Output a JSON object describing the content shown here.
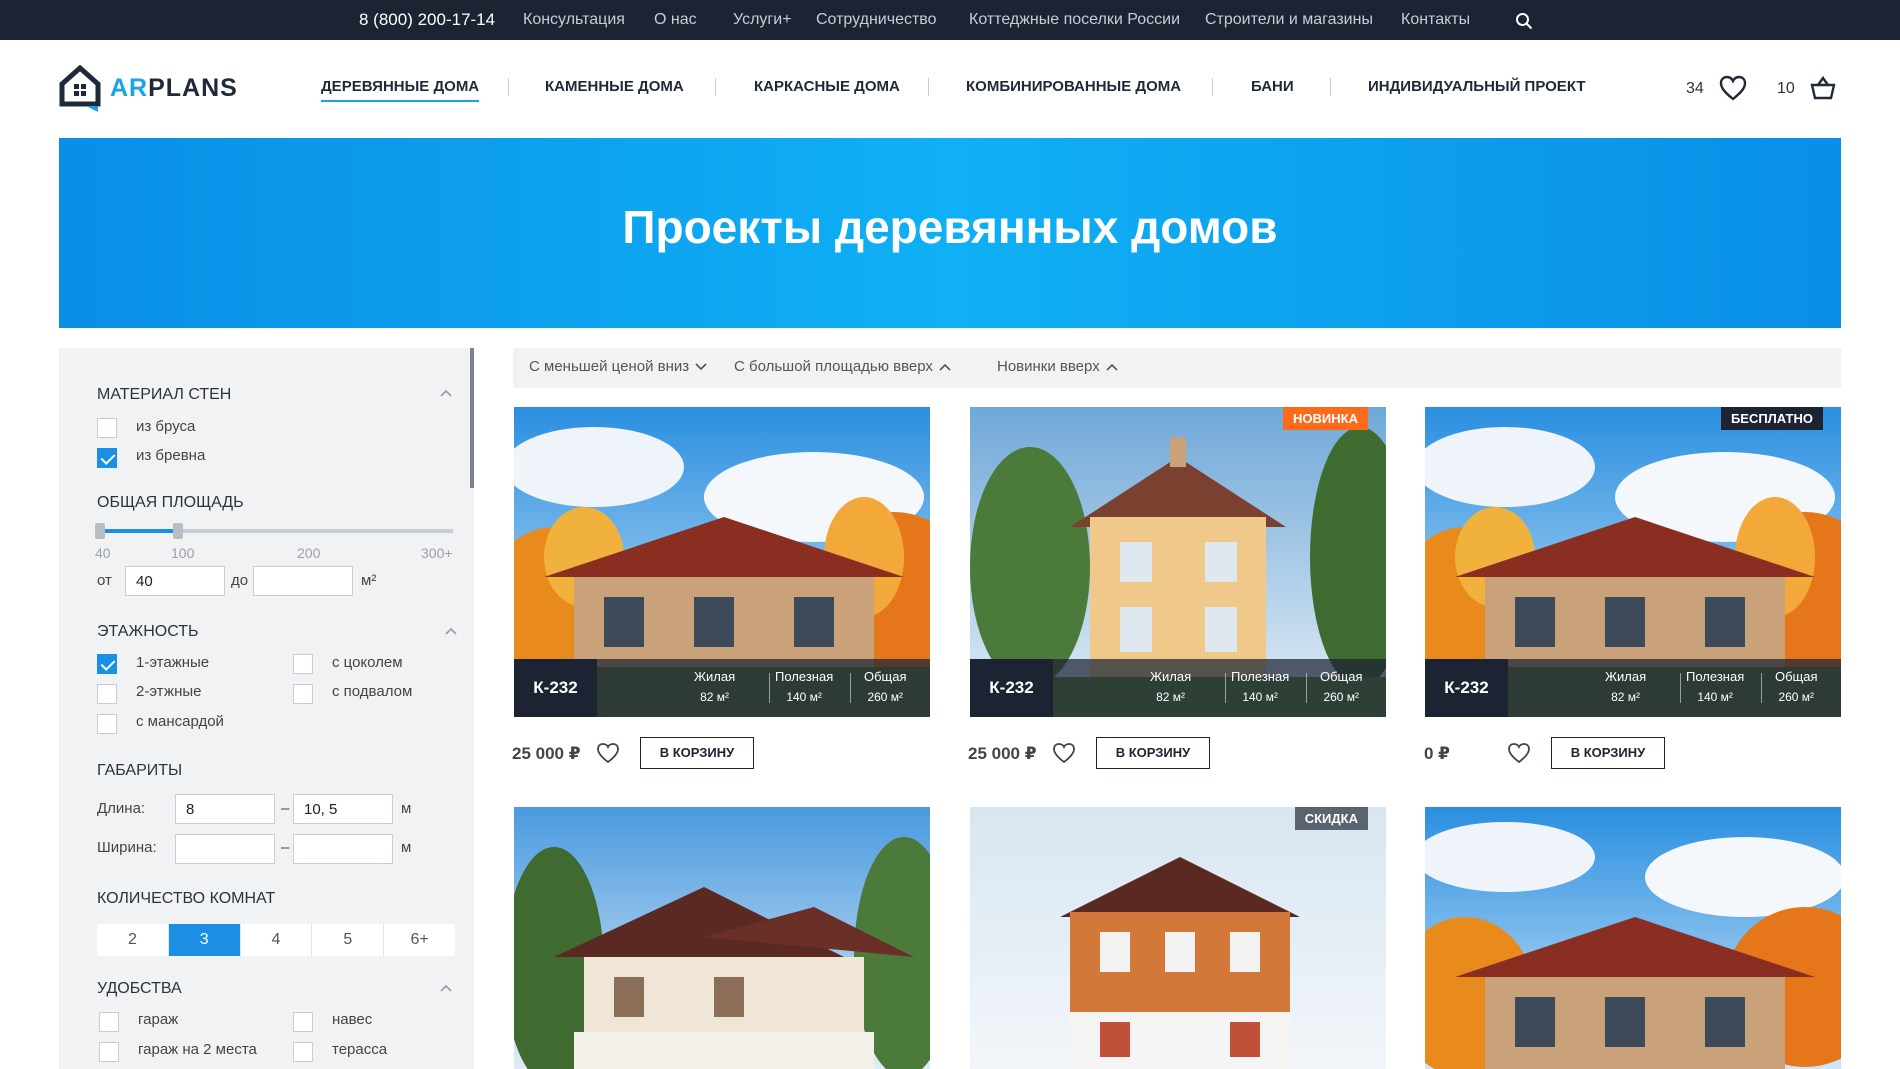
{
  "topbar": {
    "phone": "8 (800) 200-17-14",
    "links": [
      "Консультация",
      "О нас",
      "Услуги+",
      "Сотрудничество",
      "Коттеджные поселки России",
      "Строители и магазины",
      "Контакты"
    ]
  },
  "header": {
    "logo_ar": "AR",
    "logo_plans": "PLANS",
    "nav": [
      "ДЕРЕВЯННЫЕ ДОМА",
      "КАМЕННЫЕ ДОМА",
      "КАРКАСНЫЕ ДОМА",
      "КОМБИНИРОВАННЫЕ ДОМА",
      "БАНИ",
      "ИНДИВИДУАЛЬНЫЙ ПРОЕКТ"
    ],
    "favorites_count": "34",
    "cart_count": "10"
  },
  "hero": {
    "title": "Проекты деревянных домов"
  },
  "filters": {
    "material": {
      "title": "МАТЕРИАЛ СТЕН",
      "options": [
        {
          "label": "из бруса",
          "checked": false
        },
        {
          "label": "из бревна",
          "checked": true
        }
      ]
    },
    "area": {
      "title": "ОБЩАЯ ПЛОЩАДЬ",
      "ticks": [
        "40",
        "100",
        "200",
        "300+"
      ],
      "from_label": "от",
      "to_label": "до",
      "from_value": "40",
      "to_value": "",
      "unit": "м²"
    },
    "floors": {
      "title": "ЭТАЖНОСТЬ",
      "options": [
        {
          "label": "1-этажные",
          "checked": true
        },
        {
          "label": "2-этжные",
          "checked": false
        },
        {
          "label": "с мансардой",
          "checked": false
        },
        {
          "label": "с цоколем",
          "checked": false
        },
        {
          "label": "с подвалом",
          "checked": false
        }
      ]
    },
    "dims": {
      "title": "ГАБАРИТЫ",
      "length_label": "Длина:",
      "width_label": "Ширина:",
      "length_from": "8",
      "length_to": "10, 5",
      "width_from": "",
      "width_to": "",
      "dash": "–",
      "unit": "м"
    },
    "rooms": {
      "title": "КОЛИЧЕСТВО КОМНАТ",
      "options": [
        "2",
        "3",
        "4",
        "5",
        "6+"
      ],
      "selected": "3"
    },
    "amenities": {
      "title": "УДОБСТВА",
      "options": [
        {
          "label": "гараж",
          "checked": false
        },
        {
          "label": "гараж на 2 места",
          "checked": false
        },
        {
          "label": "навес",
          "checked": false
        },
        {
          "label": "терасса",
          "checked": false
        }
      ]
    }
  },
  "sort": [
    "С меньшей ценой вниз",
    "С большой площадью вверх",
    "Новинки вверх"
  ],
  "cards": [
    {
      "code": "К-232",
      "badge": "",
      "price": "25 000 ₽",
      "stats": [
        {
          "label": "Жилая",
          "value": "82 м²"
        },
        {
          "label": "Полезная",
          "value": "140 м²"
        },
        {
          "label": "Общая",
          "value": "260 м²"
        }
      ],
      "cart": "В КОРЗИНУ"
    },
    {
      "code": "К-232",
      "badge": "НОВИНКА",
      "price": "25 000 ₽",
      "stats": [
        {
          "label": "Жилая",
          "value": "82 м²"
        },
        {
          "label": "Полезная",
          "value": "140 м²"
        },
        {
          "label": "Общая",
          "value": "260 м²"
        }
      ],
      "cart": "В КОРЗИНУ"
    },
    {
      "code": "К-232",
      "badge": "БЕСПЛАТНО",
      "price": "0 ₽",
      "stats": [
        {
          "label": "Жилая",
          "value": "82 м²"
        },
        {
          "label": "Полезная",
          "value": "140 м²"
        },
        {
          "label": "Общая",
          "value": "260 м²"
        }
      ],
      "cart": "В КОРЗИНУ"
    },
    {
      "code": "",
      "badge": "",
      "price": "",
      "stats": [],
      "cart": ""
    },
    {
      "code": "",
      "badge": "СКИДКА",
      "price": "",
      "stats": [],
      "cart": ""
    },
    {
      "code": "",
      "badge": "",
      "price": "",
      "stats": [],
      "cart": ""
    }
  ]
}
